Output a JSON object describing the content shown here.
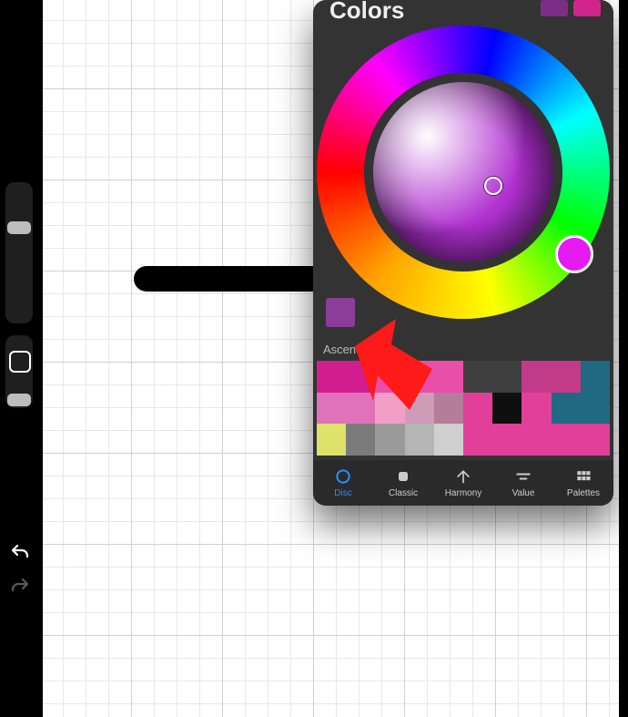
{
  "panel": {
    "title": "Colors",
    "top_swatch_a": "#7a2e86",
    "top_swatch_b": "#d1248d",
    "history_swatch": "#8a3e9a",
    "section_label": "Ascend",
    "hue_cursor_color": "#e61af2",
    "tabs": [
      {
        "label": "Disc",
        "active": true
      },
      {
        "label": "Classic",
        "active": false
      },
      {
        "label": "Harmony",
        "active": false
      },
      {
        "label": "Value",
        "active": false
      },
      {
        "label": "Palettes",
        "active": false
      }
    ],
    "palette": [
      "#d11e8e",
      "#d11e8e",
      "#e94fa8",
      "#e94fa8",
      "#e94fa8",
      "#3f3f3f",
      "#3f3f3f",
      "#c33a88",
      "#c33a88",
      "#1f6a82",
      "#e072b9",
      "#e072b9",
      "#f29fc7",
      "#ce9cb9",
      "#b37e9a",
      "#e23f9a",
      "#0f0f0f",
      "#e23f9a",
      "#1f6a82",
      "#1f6a82",
      "#dce26a",
      "#7b7b7b",
      "#9a9a9a",
      "#b5b5b5",
      "#cfcfcf",
      "#e23f9a",
      "#e23f9a",
      "#e23f9a",
      "#e23f9a",
      "#e23f9a"
    ]
  },
  "sidebar": {
    "undo_icon": "undo-icon",
    "redo_icon": "redo-icon"
  }
}
